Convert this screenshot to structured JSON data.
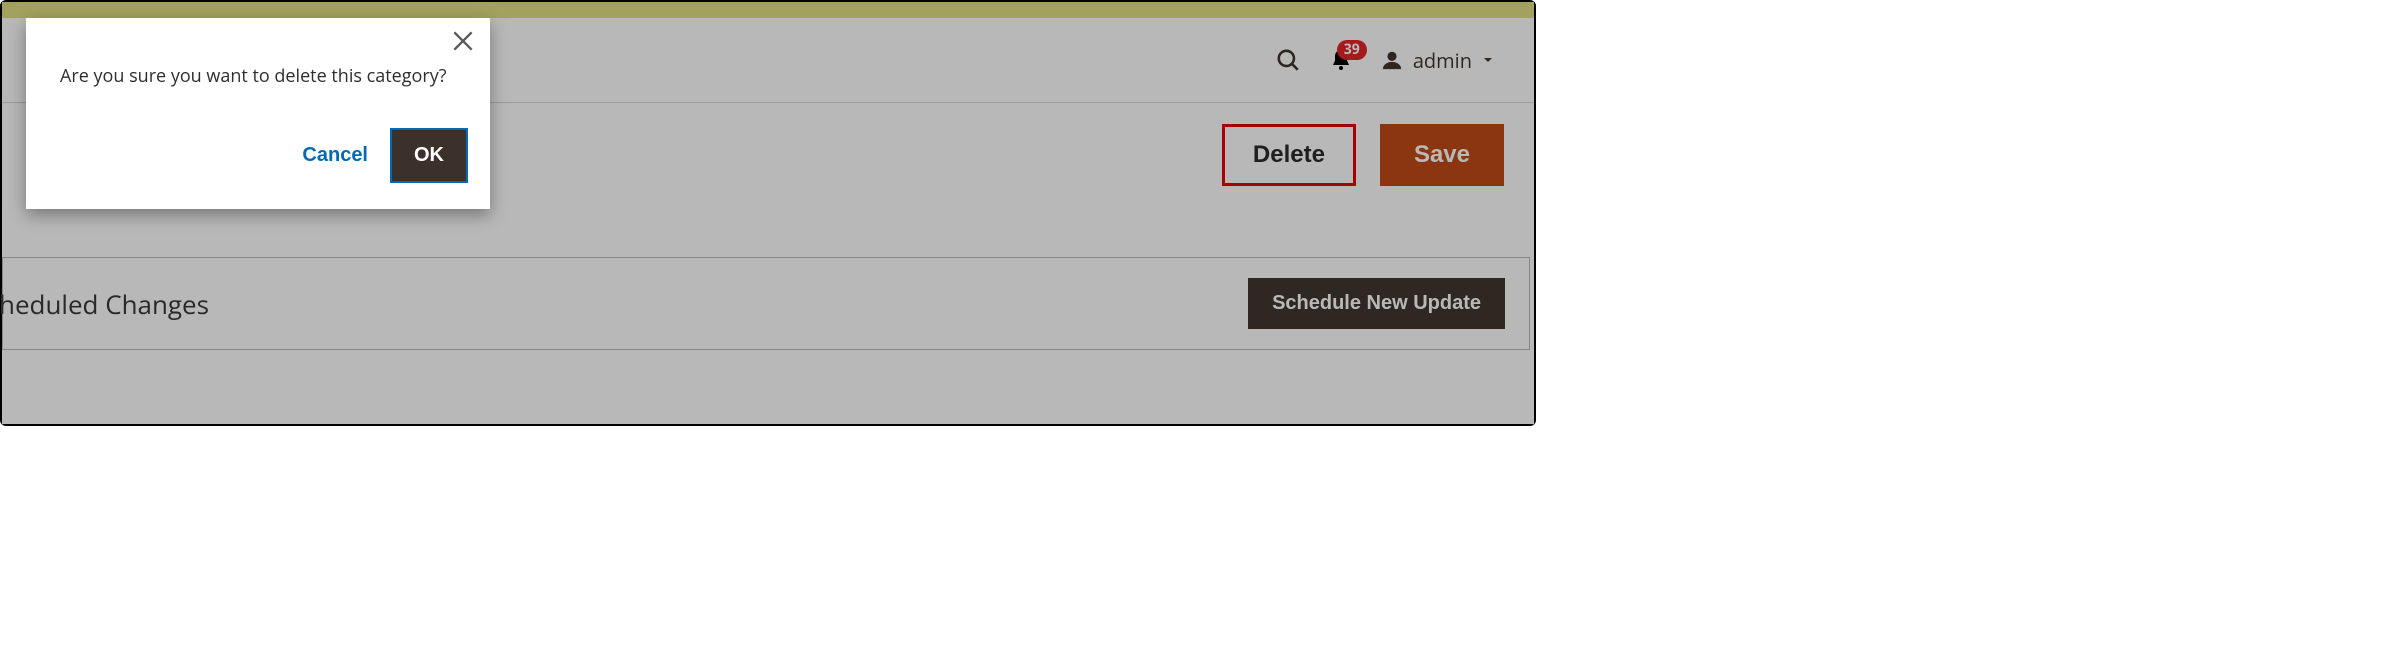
{
  "header": {
    "notification_count": "39",
    "user_name": "admin"
  },
  "actions": {
    "delete_label": "Delete",
    "save_label": "Save"
  },
  "scheduled": {
    "title": "heduled Changes",
    "new_update_label": "Schedule New Update"
  },
  "modal": {
    "message": "Are you sure you want to delete this category?",
    "cancel_label": "Cancel",
    "ok_label": "OK"
  }
}
